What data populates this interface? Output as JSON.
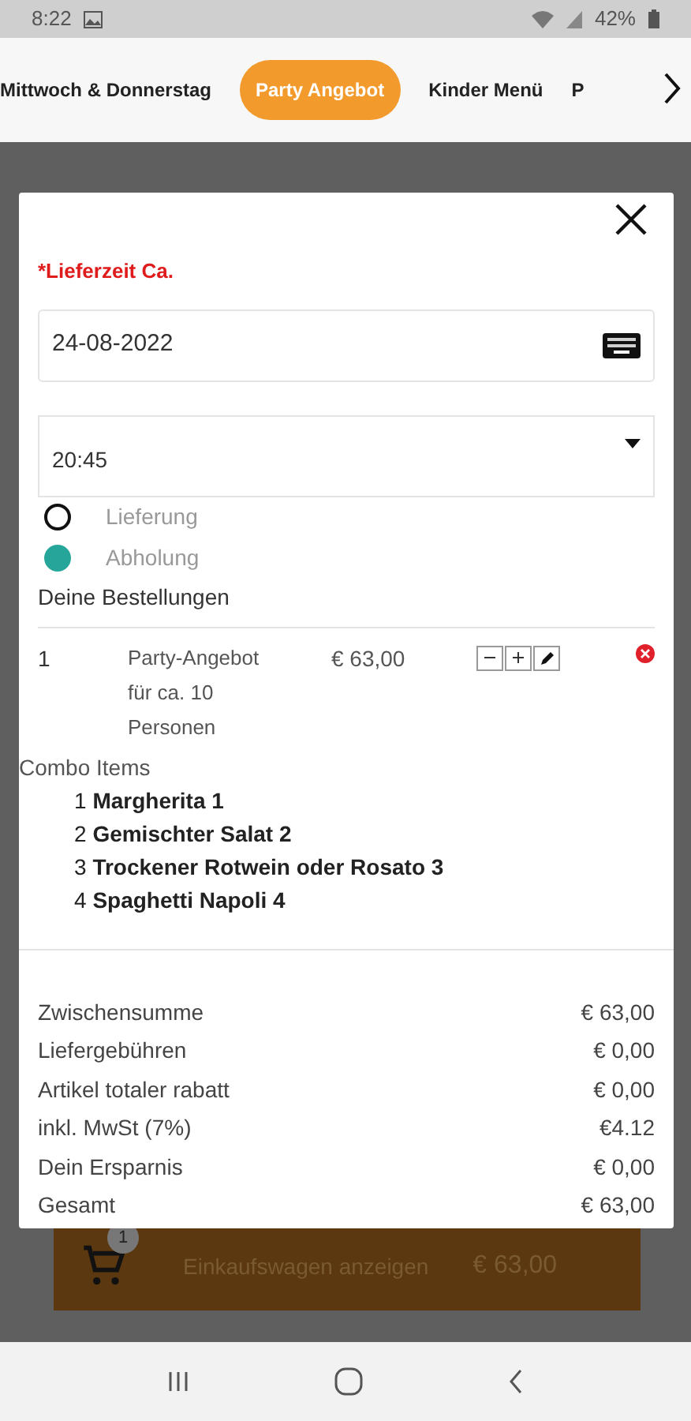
{
  "status_bar": {
    "time": "8:22",
    "battery": "42%"
  },
  "tabs": [
    {
      "label": "Mittwoch & Donnerstag",
      "selected": false
    },
    {
      "label": "Party Angebot",
      "selected": true
    },
    {
      "label": "Kinder Menü",
      "selected": false
    },
    {
      "label": "P",
      "selected": false
    }
  ],
  "modal": {
    "label": "*Lieferzeit Ca.",
    "date": "24-08-2022",
    "time": "20:45",
    "options": [
      {
        "label": "Lieferung",
        "selected": false
      },
      {
        "label": "Abholung",
        "selected": true
      }
    ],
    "orders_title": "Deine Bestellungen",
    "order": {
      "qty": "1",
      "name": "Party-Angebot für ca. 10 Personen",
      "price": "€ 63,00"
    },
    "combo_title": "Combo Items",
    "combo_items": [
      "1 **Margherita 1**",
      "2 **Gemischter Salat 2**",
      "3 **Trockener Rotwein oder Rosato 3**",
      "4 **Spaghetti Napoli 4**"
    ],
    "summary": [
      {
        "label": "Zwischensumme",
        "value": "€ 63,00"
      },
      {
        "label": "Liefergebühren",
        "value": "€ 0,00"
      },
      {
        "label": "Artikel totaler rabatt",
        "value": "€ 0,00"
      },
      {
        "label": "inkl. MwSt (7%)",
        "value": "€4.12"
      },
      {
        "label": "Dein Ersparnis",
        "value": "€ 0,00"
      },
      {
        "label": "Gesamt",
        "value": "€ 63,00"
      }
    ]
  },
  "cart": {
    "badge": "1",
    "label": "Einkaufswagen anzeigen",
    "total": "€ 63,00"
  }
}
